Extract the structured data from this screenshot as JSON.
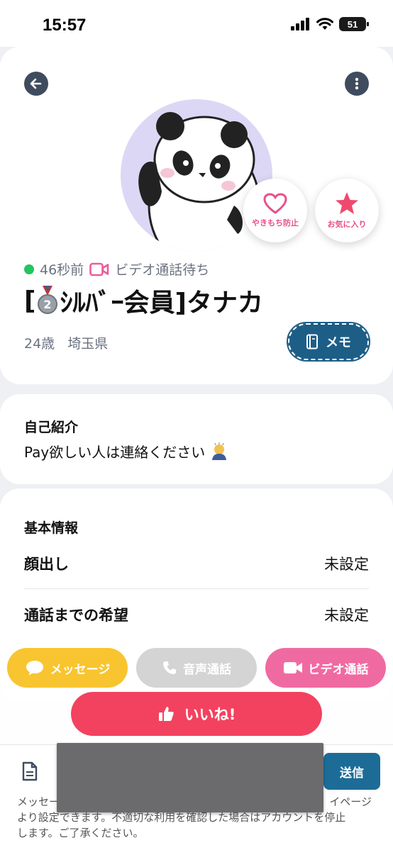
{
  "status_bar": {
    "time": "15:57",
    "battery": "51"
  },
  "profile": {
    "online": "46秒前",
    "video_status": "ビデオ通話待ち",
    "name_prefix": "[",
    "name_rest": "ｼﾙﾊﾞｰ会員]タナカ",
    "medal_number": "2",
    "age": "24歳",
    "location": "埼玉県",
    "jealousy_label": "やきもち防止",
    "favorite_label": "お気に入り",
    "memo_label": "メモ"
  },
  "intro": {
    "title": "自己紹介",
    "text": "Pay欲しい人は連絡ください"
  },
  "basic_info": {
    "title": "基本情報",
    "rows": [
      {
        "label": "顔出し",
        "value": "未設定"
      },
      {
        "label": "通話までの希望",
        "value": "未設定"
      }
    ]
  },
  "actions": {
    "message": "メッセージ",
    "voice_call": "音声通話",
    "video_call": "ビデオ通話",
    "like": "いいね!"
  },
  "composer": {
    "send": "送信",
    "notice_line1": "メッセー",
    "notice_line1_end": "イページ",
    "notice_line2": "より設定できます。不適切な利用を確認した場合はアカウントを停止",
    "notice_line3": "します。ご了承ください。"
  },
  "colors": {
    "accent_blue": "#1d5e87",
    "like_red": "#f2425f",
    "message_yellow": "#f8c530",
    "video_pink": "#f06aa2",
    "voice_gray": "#d4d4d4"
  }
}
